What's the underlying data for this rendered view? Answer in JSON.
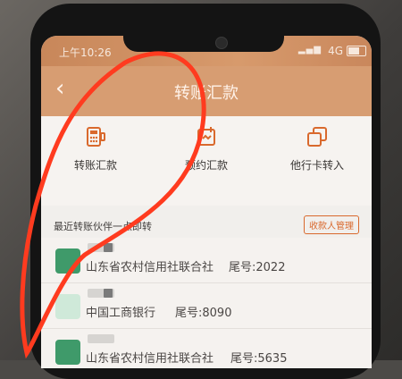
{
  "status": {
    "time": "上午10:26",
    "network": "4G"
  },
  "header": {
    "title": "转账汇款",
    "back_glyph": "‹"
  },
  "actions": [
    {
      "label": "转账汇款",
      "icon": "pos-terminal-icon"
    },
    {
      "label": "预约汇款",
      "icon": "calendar-icon"
    },
    {
      "label": "他行卡转入",
      "icon": "copy-icon"
    }
  ],
  "recent": {
    "label": "最近转账伙伴一点即转",
    "manage_label": "收款人管理"
  },
  "payees": [
    {
      "bank": "山东省农村信用社联合社",
      "tail": "尾号:2022"
    },
    {
      "bank": "中国工商银行",
      "tail": "尾号:8090"
    },
    {
      "bank": "山东省农村信用社联合社",
      "tail": "尾号:5635"
    }
  ],
  "colors": {
    "header": "#d79d72",
    "accent": "#d9692d",
    "annotation": "#ff3b1f"
  }
}
